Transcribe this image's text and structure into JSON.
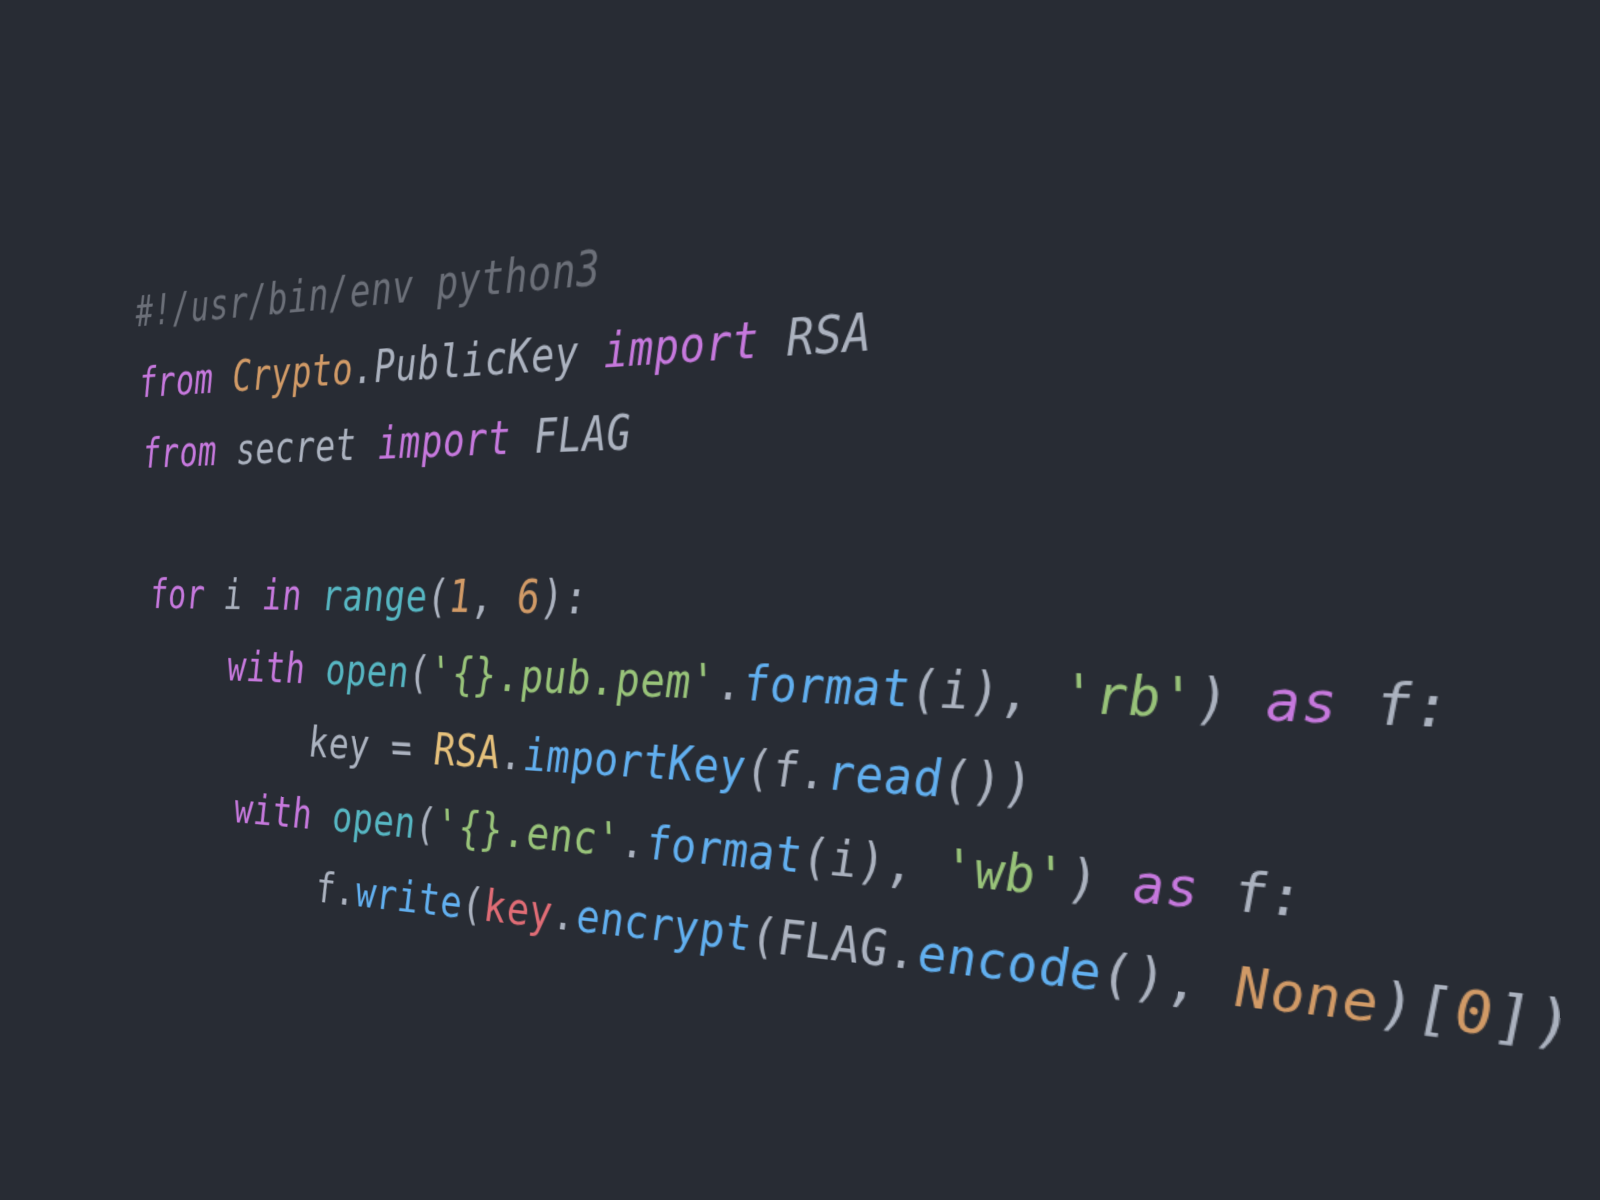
{
  "code": {
    "line1": {
      "shebang": "#!/usr/bin/env python3"
    },
    "line2": {
      "kw_from": "from",
      "module1": "Crypto",
      "dot": ".",
      "module2": "PublicKey",
      "kw_import": "import",
      "target": "RSA"
    },
    "line3": {
      "kw_from": "from",
      "module": "secret",
      "kw_import": "import",
      "target": "FLAG"
    },
    "line5": {
      "kw_for": "for",
      "var": "i",
      "kw_in": "in",
      "fn": "range",
      "lp": "(",
      "arg1": "1",
      "comma": ", ",
      "arg2": "6",
      "rp": ")",
      "colon": ":"
    },
    "line6": {
      "kw_with": "with",
      "fn_open": "open",
      "lp": "(",
      "str1": "'{}.pub.pem'",
      "dot": ".",
      "fn_format": "format",
      "lp2": "(",
      "arg": "i",
      "rp2": ")",
      "comma": ", ",
      "str2": "'rb'",
      "rp": ")",
      "kw_as": "as",
      "var": "f",
      "colon": ":"
    },
    "line7": {
      "var_key": "key",
      "eq": " = ",
      "cls": "RSA",
      "dot1": ".",
      "fn_import": "importKey",
      "lp": "(",
      "var_f": "f",
      "dot2": ".",
      "fn_read": "read",
      "lp2": "(",
      "rp2": ")",
      "rp": ")"
    },
    "line8": {
      "kw_with": "with",
      "fn_open": "open",
      "lp": "(",
      "str1": "'{}.enc'",
      "dot": ".",
      "fn_format": "format",
      "lp2": "(",
      "arg": "i",
      "rp2": ")",
      "comma": ", ",
      "str2": "'wb'",
      "rp": ")",
      "kw_as": "as",
      "var": "f",
      "colon": ":"
    },
    "line9": {
      "var_f": "f",
      "dot1": ".",
      "fn_write": "write",
      "lp": "(",
      "var_key": "key",
      "dot2": ".",
      "fn_encrypt": "encrypt",
      "lp2": "(",
      "const_flag": "FLAG",
      "dot3": ".",
      "fn_encode": "encode",
      "lp3": "(",
      "rp3": ")",
      "comma": ", ",
      "const_none": "None",
      "rp2": ")",
      "lbr": "[",
      "idx": "0",
      "rbr": "]",
      "rp": ")"
    }
  }
}
